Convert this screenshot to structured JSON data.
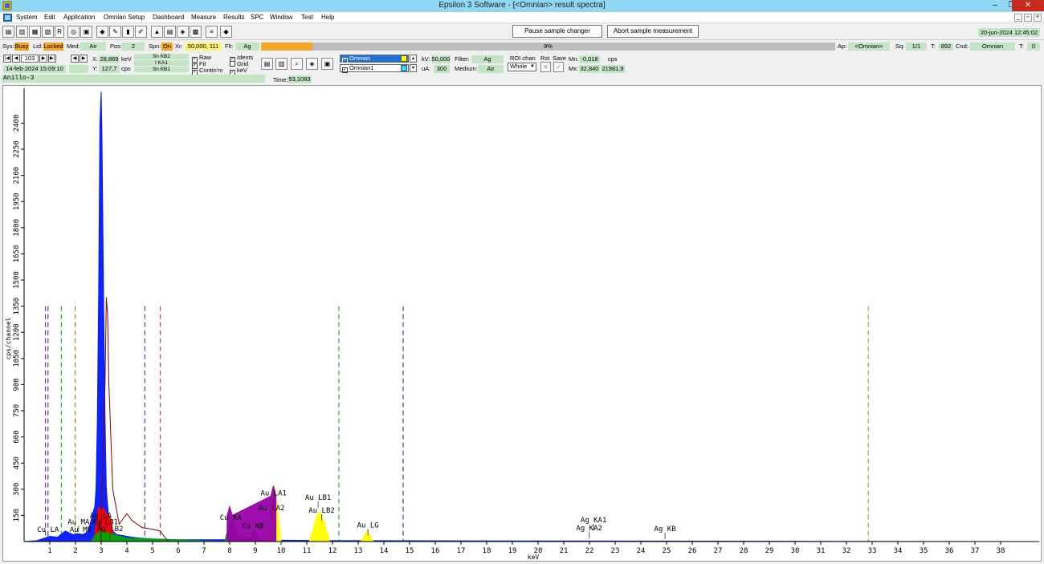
{
  "window": {
    "title": "Epsilon 3 Software - [<Omnian> result spectra]",
    "minimize": "–",
    "restore": "❐",
    "close": "✕"
  },
  "menu": [
    "System",
    "Edit",
    "Application",
    "Omnian Setup",
    "Dashboard",
    "Measure",
    "Results",
    "SPC",
    "Window",
    "Test",
    "Help"
  ],
  "toolbar": {
    "pause_label": "Pause sample changer",
    "abort_label": "Abort sample measurement",
    "datetime": "20-jun-2024 12:45:02"
  },
  "status": {
    "sys_label": "Sys:",
    "sys": "Busy",
    "lid_label": "Lid:",
    "lid": "Locked",
    "med_label": "Med:",
    "med": "Air",
    "pos_label": "Pos:",
    "pos": "2",
    "spn_label": "Spn:",
    "spn": "On",
    "xr_label": "Xr:",
    "xr": "50,000, 111",
    "flt_label": "Flt:",
    "flt": "Ag",
    "progress_text": "9%",
    "progress": 0.09,
    "ap_label": "Ap:",
    "ap": "<Omnian>",
    "sq_label": "Sq:",
    "sq": "1/1",
    "t_label": "T:",
    "t": "892",
    "cnd_label": "Cnd:",
    "cnd": "Omnian",
    "t2_label": "T:",
    "t2": "0"
  },
  "controls": {
    "spectrum_number": "103",
    "date": "14-feb-2024 15:09:10",
    "x_label": "X:",
    "x_value": "28,869",
    "x_unit": "keV",
    "y_label": "Y:",
    "y_value": "127,7",
    "y_unit": "cps",
    "lines": [
      "Sn KB2",
      "I KA1",
      "Sn KB1"
    ],
    "raw": "Raw",
    "fit": "Fit",
    "continuum": "Contin'm",
    "idents": "Idents",
    "grid": "Grid",
    "kev": "keV",
    "channels": [
      {
        "name": "Omnian",
        "color": "#ffff00"
      },
      {
        "name": "Omnian1",
        "color": "#33ccff"
      }
    ],
    "kv_label": "kV:",
    "kv": "50,000",
    "ua_label": "uA:",
    "ua": "300",
    "filter_label": "Filter:",
    "filter": "Ag",
    "medium_label": "Medium:",
    "medium": "Air",
    "roi_label": "ROI chan",
    "roi": "Whole",
    "rst_label": "Rst",
    "save_label": "Save",
    "mn_label": "Mn:",
    "mn": "-0,018",
    "mn_unit": "cps",
    "mx_label": "Mx:",
    "mx": "32,840",
    "mx2": "21981,9",
    "sample_name": "Anillo-3",
    "time_label": "Time:",
    "time": "53,1083"
  },
  "chart_data": {
    "type": "line",
    "xlabel": "keV",
    "ylabel": "cps/channel",
    "xlim": [
      0,
      39.5
    ],
    "ylim": [
      0,
      2600
    ],
    "xticks": [
      1,
      2,
      3,
      4,
      5,
      6,
      7,
      8,
      9,
      10,
      11,
      12,
      13,
      14,
      15,
      16,
      17,
      18,
      19,
      20,
      21,
      22,
      23,
      24,
      25,
      26,
      27,
      28,
      29,
      30,
      31,
      32,
      33,
      34,
      35,
      36,
      37,
      38
    ],
    "yticks": [
      150,
      300,
      450,
      600,
      750,
      900,
      1050,
      1200,
      1350,
      1500,
      1650,
      1800,
      1950,
      2100,
      2250,
      2400
    ],
    "series": [
      {
        "color": "#0018ff",
        "x": [
          0,
          0.5,
          0.8,
          1.0,
          1.3,
          1.6,
          1.9,
          2.1,
          2.3,
          2.5,
          2.65,
          2.75,
          2.8,
          2.85,
          2.9,
          2.95,
          3.0,
          3.03,
          3.06,
          3.1,
          3.15,
          3.2,
          3.3,
          3.45,
          3.6,
          3.8,
          4.0,
          4.2,
          4.5,
          5.0,
          6,
          8,
          12,
          20,
          39.5
        ],
        "y": [
          0,
          5,
          20,
          30,
          25,
          60,
          40,
          45,
          40,
          60,
          150,
          200,
          300,
          700,
          1400,
          2400,
          2580,
          2300,
          1900,
          1300,
          700,
          300,
          120,
          60,
          40,
          35,
          30,
          25,
          20,
          15,
          10,
          10,
          5,
          3,
          0
        ]
      },
      {
        "color": "#ff0000",
        "x": [
          2.7,
          2.9,
          3.0,
          3.1,
          3.2,
          3.3,
          3.4,
          3.5
        ],
        "y": [
          0,
          200,
          180,
          190,
          160,
          150,
          120,
          0
        ]
      },
      {
        "color": "#00aa00",
        "x": [
          2.6,
          2.8,
          3.0,
          3.2,
          3.5,
          4.0,
          7.8,
          8.0,
          8.1,
          8.3,
          8.8,
          9.0,
          9.2
        ],
        "y": [
          0,
          40,
          60,
          50,
          40,
          20,
          0,
          110,
          130,
          40,
          20,
          60,
          0
        ]
      },
      {
        "color": "#ffff00",
        "x": [
          9.3,
          9.5,
          9.65,
          9.75,
          9.85,
          10.0,
          11.1,
          11.4,
          11.5,
          11.6,
          11.9,
          13.1,
          13.35,
          13.6
        ],
        "y": [
          0,
          80,
          290,
          320,
          200,
          0,
          0,
          150,
          170,
          150,
          0,
          0,
          60,
          0
        ]
      },
      {
        "color": "#8b0000",
        "x": [
          3.0,
          3.15,
          3.2,
          3.25,
          3.3,
          3.45,
          3.7,
          4.0,
          4.2,
          4.6,
          5.0,
          5.3,
          5.6
        ],
        "y": [
          100,
          900,
          1400,
          1300,
          900,
          300,
          100,
          160,
          120,
          80,
          70,
          60,
          0
        ]
      },
      {
        "color": "#9900aa",
        "x": [
          7.9,
          8.0,
          8.1,
          9.6,
          9.7,
          9.8
        ],
        "y": [
          150,
          200,
          150,
          260,
          320,
          260
        ]
      }
    ],
    "vlines": [
      {
        "x": 0.83,
        "color": "#7030a0"
      },
      {
        "x": 0.93,
        "color": "#7030a0"
      },
      {
        "x": 1.45,
        "color": "#33aa33"
      },
      {
        "x": 1.99,
        "color": "#b8860b"
      },
      {
        "x": 4.7,
        "color": "#4b4bb8"
      },
      {
        "x": 5.3,
        "color": "#b84b4b"
      },
      {
        "x": 12.25,
        "color": "#33aa33"
      },
      {
        "x": 14.75,
        "color": "#7030a0"
      },
      {
        "x": 32.85,
        "color": "#7cb342"
      }
    ],
    "annotations": [
      {
        "text": "Cu LA",
        "x": 0.93,
        "y": 55
      },
      {
        "text": "Au MA",
        "x": 2.12,
        "y": 100
      },
      {
        "text": "Au MB",
        "x": 2.2,
        "y": 55
      },
      {
        "text": "Ag LA",
        "x": 2.98,
        "y": 135
      },
      {
        "text": "Ag LB1",
        "x": 3.15,
        "y": 100
      },
      {
        "text": "Ag LB2",
        "x": 3.35,
        "y": 60
      },
      {
        "text": "Cu KA",
        "x": 8.04,
        "y": 125
      },
      {
        "text": "Cu KB",
        "x": 8.9,
        "y": 75
      },
      {
        "text": "Au LA1",
        "x": 9.71,
        "y": 265
      },
      {
        "text": "Au LA2",
        "x": 9.63,
        "y": 180
      },
      {
        "text": "Au LB1",
        "x": 11.44,
        "y": 240
      },
      {
        "text": "Au LB2",
        "x": 11.58,
        "y": 165
      },
      {
        "text": "Au LG",
        "x": 13.38,
        "y": 80
      },
      {
        "text": "Ag KA1",
        "x": 22.16,
        "y": 110
      },
      {
        "text": "Ag KA2",
        "x": 21.99,
        "y": 65
      },
      {
        "text": "Ag KB",
        "x": 24.94,
        "y": 60
      }
    ]
  }
}
